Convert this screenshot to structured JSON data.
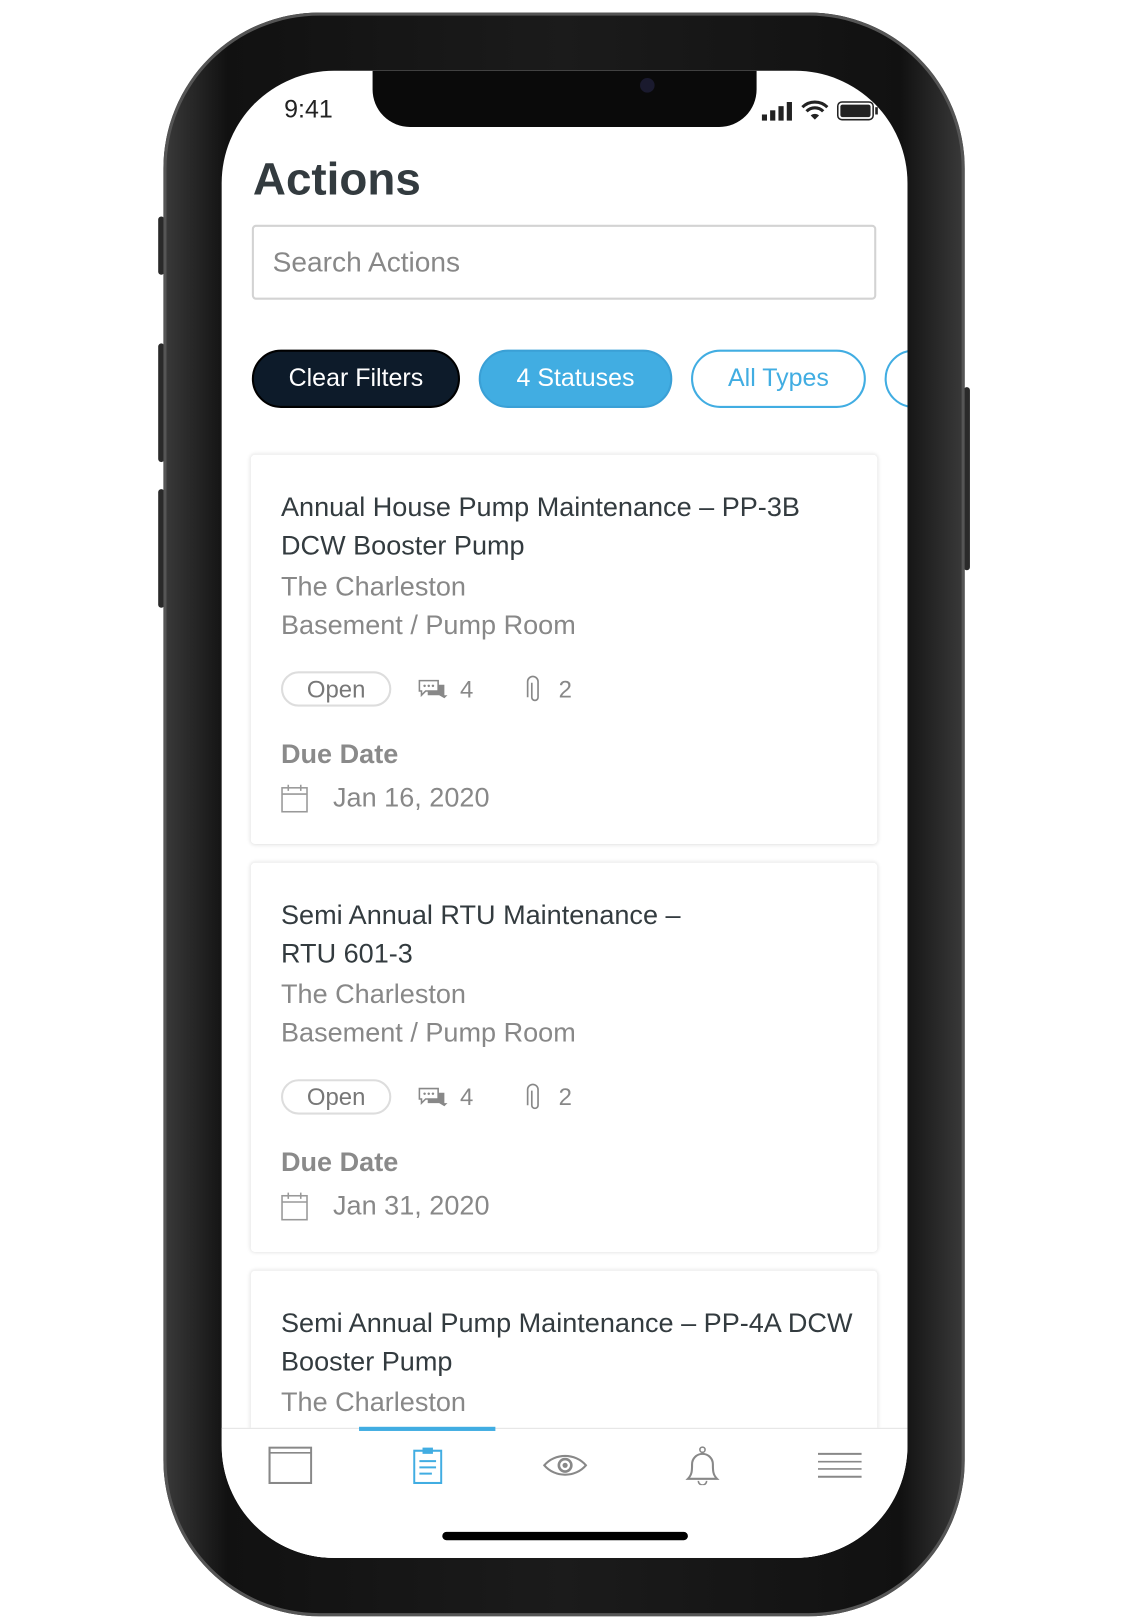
{
  "status_bar": {
    "time": "9:41",
    "icons": [
      "signal-icon",
      "wifi-icon",
      "battery-icon"
    ]
  },
  "header": {
    "title": "Actions"
  },
  "search": {
    "placeholder": "Search Actions",
    "value": ""
  },
  "filters": [
    {
      "label": "Clear Filters"
    },
    {
      "label": "4 Statuses"
    },
    {
      "label": "All Types"
    }
  ],
  "cards": [
    {
      "title": "Annual House Pump Maintenance – PP-3B DCW Booster Pump",
      "building": "The Charleston",
      "location": "Basement / Pump Room",
      "status": "Open",
      "comments": "4",
      "attachments": "2",
      "due_label": "Due Date",
      "due_date": "Jan 16, 2020"
    },
    {
      "title": "Semi Annual RTU Maintenance – RTU 601-3",
      "building": "The Charleston",
      "location": "Basement / Pump Room",
      "status": "Open",
      "comments": "4",
      "attachments": "2",
      "due_label": "Due Date",
      "due_date": "Jan 31, 2020"
    },
    {
      "title": "Semi Annual Pump Maintenance – PP-4A DCW Booster Pump",
      "building": "The Charleston"
    }
  ],
  "tabbar": {
    "items": [
      "dashboard-icon",
      "clipboard-icon",
      "eye-icon",
      "bell-icon",
      "menu-icon"
    ],
    "active": 1
  },
  "colors": {
    "accent": "#41ade2",
    "dark": "#0d1b2a",
    "text": "#333b3f",
    "muted": "#888888"
  }
}
